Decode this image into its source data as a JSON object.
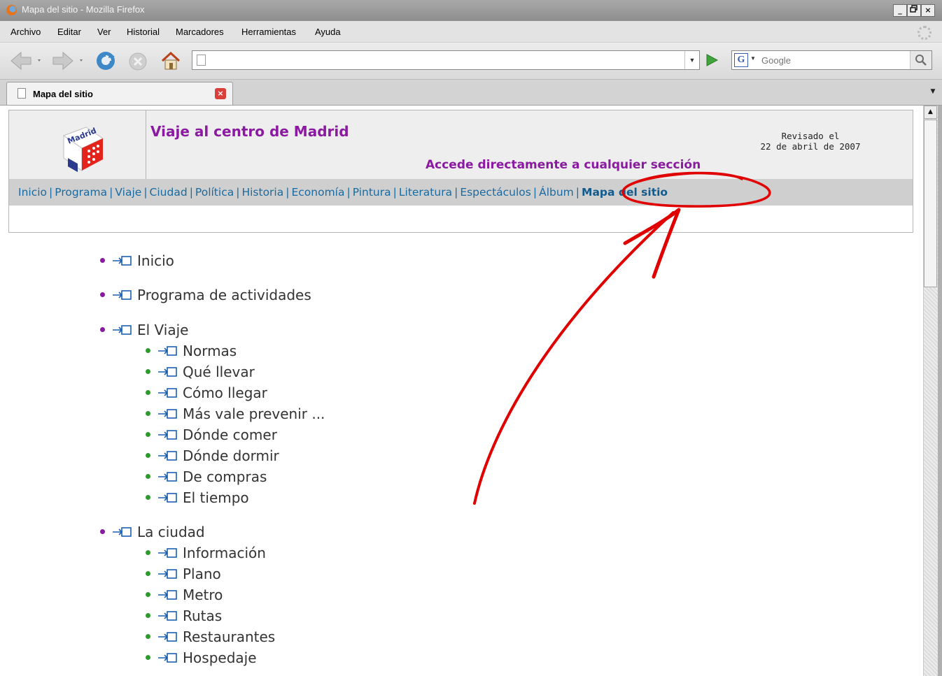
{
  "window": {
    "title": "Mapa del sitio - Mozilla Firefox",
    "controls": [
      "_",
      "▫",
      "×"
    ]
  },
  "menu": [
    "Archivo",
    "Editar",
    "Ver",
    "Historial",
    "Marcadores",
    "Herramientas",
    "Ayuda"
  ],
  "toolbar": {
    "url_value": "",
    "search_placeholder": "Google"
  },
  "tab": {
    "label": "Mapa del sitio"
  },
  "site": {
    "title": "Viaje al centro de Madrid",
    "subtitle": "Accede directamente a cualquier sección",
    "revised_line1": "Revisado el",
    "revised_line2": "22 de abril de 2007",
    "logo_text": "Madrid",
    "nav": [
      "Inicio",
      "Programa",
      "Viaje",
      "Ciudad",
      "Política",
      "Historia",
      "Economía",
      "Pintura",
      "Literatura",
      "Espectáculos",
      "Álbum"
    ],
    "nav_current": "Mapa del sitio"
  },
  "sitemap": [
    {
      "label": "Inicio",
      "children": []
    },
    {
      "label": "Programa de actividades",
      "children": []
    },
    {
      "label": "El Viaje",
      "children": [
        "Normas",
        "Qué llevar",
        "Cómo llegar",
        "Más vale prevenir ...",
        "Dónde comer",
        "Dónde dormir",
        "De compras",
        "El tiempo"
      ]
    },
    {
      "label": "La ciudad",
      "children": [
        "Información",
        "Plano",
        "Metro",
        "Rutas",
        "Restaurantes",
        "Hospedaje"
      ]
    }
  ],
  "colors": {
    "title_purple": "#8a1aa0",
    "link_blue": "#1a6aa0",
    "bullet_top": "#8a1aa0",
    "bullet_sub": "#2e9a2e",
    "annotation_red": "#e00000"
  }
}
